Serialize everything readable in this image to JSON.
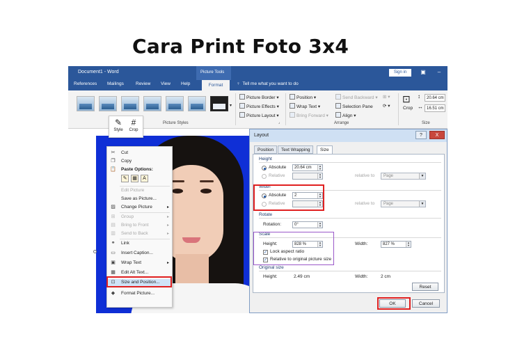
{
  "page": {
    "title": "Cara Print Foto 3x4"
  },
  "titlebar": {
    "document": "Document1 - Word",
    "picture_tools": "Picture Tools",
    "sign_in": "Sign in"
  },
  "tabs": {
    "items": [
      "References",
      "Mailings",
      "Review",
      "View",
      "Help"
    ],
    "active": "Format",
    "tell_me": "Tell me what you want to do"
  },
  "ribbon": {
    "picture_styles_label": "Picture Styles",
    "picture_border": "Picture Border",
    "picture_effects": "Picture Effects",
    "picture_layout": "Picture Layout",
    "position": "Position",
    "wrap_text": "Wrap Text",
    "bring_forward": "Bring Forward",
    "send_backward": "Send Backward",
    "selection_pane": "Selection Pane",
    "align": "Align",
    "arrange_label": "Arrange",
    "crop": "Crop",
    "size_label": "Size",
    "height": "20.64 cm",
    "width": "16.51 cm"
  },
  "float_tools": {
    "style": "Style",
    "crop": "Crop"
  },
  "context_menu": {
    "cut": "Cut",
    "copy": "Copy",
    "paste_options": "Paste Options:",
    "edit_picture": "Edit Picture",
    "save_as_picture": "Save as Picture...",
    "change_picture": "Change Picture",
    "group": "Group",
    "bring_to_front": "Bring to Front",
    "send_to_back": "Send to Back",
    "link": "Link",
    "insert_caption": "Insert Caption...",
    "wrap_text": "Wrap Text",
    "edit_alt_text": "Edit Alt Text...",
    "size_and_position": "Size and Position...",
    "format_picture": "Format Picture..."
  },
  "dialog": {
    "title": "Layout",
    "help": "?",
    "close": "X",
    "tabs": [
      "Position",
      "Text Wrapping",
      "Size"
    ],
    "height_section": "Height",
    "absolute_label": "Absolute",
    "height_absolute": "20.64 cm",
    "relative_label": "Relative",
    "relative_to": "relative to",
    "page_option": "Page",
    "width_section": "Width",
    "width_absolute": "2",
    "rotate_section": "Rotate",
    "rotation_label": "Rotation:",
    "rotation_value": "0°",
    "scale_section": "Scale",
    "scale_height_label": "Height:",
    "scale_height": "828 %",
    "scale_width_label": "Width:",
    "scale_width": "827 %",
    "lock_aspect": "Lock aspect ratio",
    "relative_original": "Relative to original picture size",
    "original_size_section": "Original size",
    "orig_height_label": "Height:",
    "orig_height": "2.49 cm",
    "orig_width_label": "Width:",
    "orig_width": "2 cm",
    "reset": "Reset",
    "ok": "OK",
    "cancel": "Cancel"
  }
}
